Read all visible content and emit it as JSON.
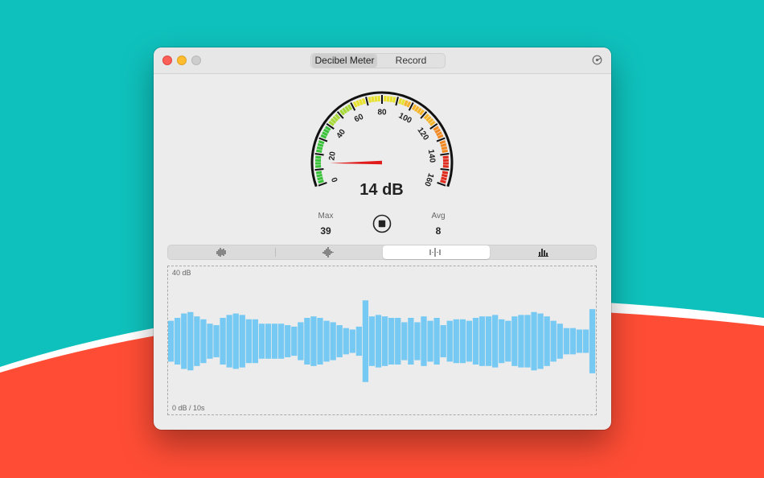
{
  "window": {
    "tabs": [
      {
        "label": "Decibel Meter",
        "active": true
      },
      {
        "label": "Record",
        "active": false
      }
    ],
    "settings_icon": "settings-icon"
  },
  "gauge": {
    "min": 0,
    "max": 160,
    "tick_labels": [
      "0",
      "20",
      "40",
      "60",
      "80",
      "100",
      "120",
      "140",
      "160"
    ],
    "needle_value": 14,
    "readout": "14 dB",
    "colors": {
      "low": "#3ac33a",
      "mid": "#e8e22e",
      "high": "#f28a24",
      "peak": "#e02c1e",
      "needle": "#e01b1b"
    }
  },
  "stats": {
    "max_label": "Max",
    "max_value": "39",
    "avg_label": "Avg",
    "avg_value": "8"
  },
  "controls": {
    "stop_icon": "stop-icon"
  },
  "modes": [
    {
      "icon": "waveform-icon",
      "active": false
    },
    {
      "icon": "waveform-burst-icon",
      "active": false
    },
    {
      "icon": "waveform-sparse-icon",
      "active": true
    },
    {
      "icon": "bar-histogram-icon",
      "active": false
    }
  ],
  "chart_data": {
    "type": "bar",
    "title": "",
    "top_label": "40 dB",
    "bottom_label": "0 dB / 10s",
    "ylim": [
      0,
      40
    ],
    "bar_color": "#75c9f2",
    "values": [
      14,
      16,
      19,
      20,
      17,
      15,
      12,
      11,
      16,
      18,
      19,
      18,
      15,
      15,
      12,
      12,
      12,
      12,
      11,
      10,
      13,
      16,
      17,
      16,
      14,
      13,
      11,
      9,
      8,
      10,
      28,
      17,
      18,
      17,
      16,
      16,
      13,
      16,
      13,
      17,
      14,
      16,
      11,
      14,
      15,
      15,
      14,
      16,
      17,
      17,
      18,
      15,
      14,
      17,
      18,
      18,
      20,
      19,
      17,
      14,
      12,
      9,
      9,
      8,
      8,
      22
    ]
  }
}
